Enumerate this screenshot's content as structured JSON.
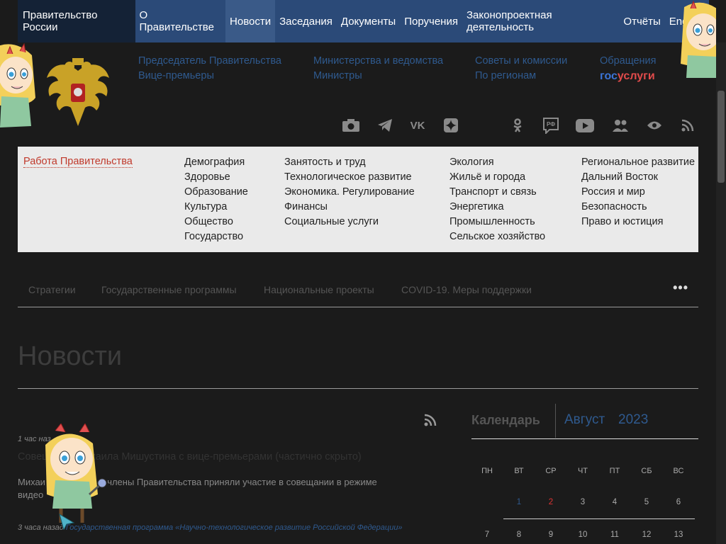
{
  "topnav": {
    "brand": "Правительство России",
    "items": [
      "О Правительстве",
      "Новости",
      "Заседания",
      "Документы",
      "Поручения",
      "Законопроектная деятельность",
      "Отчёты",
      "Eng"
    ],
    "active_index": 1
  },
  "header_links": {
    "col1": [
      "Председатель Правительства",
      "Вице-премьеры"
    ],
    "col2": [
      "Министерства и ведомства",
      "Министры"
    ],
    "col3": [
      "Советы и комиссии",
      "По регионам"
    ],
    "col4_top": "Обращения",
    "gosuslugi": {
      "part1": "гос",
      "part2": "услуги"
    }
  },
  "social_icons": [
    "camera-icon",
    "telegram-icon",
    "vk-icon",
    "zen-icon",
    "odnoklassniki-icon",
    "rutube-icon",
    "youtube-icon",
    "community-icon",
    "accessibility-eye-icon",
    "rss-icon"
  ],
  "social_glyphs": {
    "vk": "VK",
    "rf": "РФ"
  },
  "topics": {
    "work": "Работа Правительства",
    "col1": [
      "Демография",
      "Здоровье",
      "Образование",
      "Культура",
      "Общество",
      "Государство"
    ],
    "col2": [
      "Занятость и труд",
      "Технологическое развитие",
      "Экономика. Регулирование",
      "Финансы",
      "Социальные услуги"
    ],
    "col3": [
      "Экология",
      "Жильё и города",
      "Транспорт и связь",
      "Энергетика",
      "Промышленность",
      "Сельское хозяйство"
    ],
    "col4": [
      "Региональное развитие",
      "Дальний Восток",
      "Россия и мир",
      "Безопасность",
      "Право и юстиция"
    ]
  },
  "subnav": [
    "Стратегии",
    "Государственные программы",
    "Национальные проекты",
    "COVID-19. Меры поддержки"
  ],
  "subnav_more": "•••",
  "page_title": "Новости",
  "news": [
    {
      "time": "1 час наз",
      "title": "Совещание Михаила Мишустина с вице-премьерами (частично скрыто)",
      "lead_visible_start": "Михаи",
      "lead_visible_end": "члены Правительства приняли участие в совещании в режиме",
      "lead_line2": "видео"
    },
    {
      "time": "3 часа назад",
      "tag": "Государственная программа «Научно-технологическое развитие Российской Федерации»"
    }
  ],
  "calendar": {
    "label": "Календарь",
    "month": "Август",
    "year": "2023",
    "weekdays": [
      "ПН",
      "ВТ",
      "СР",
      "ЧТ",
      "ПТ",
      "СБ",
      "ВС"
    ],
    "week1": [
      "",
      "1",
      "2",
      "3",
      "4",
      "5",
      "6"
    ],
    "week2": [
      "7",
      "8",
      "9",
      "10",
      "11",
      "12",
      "13"
    ]
  },
  "colors": {
    "topnav": "#2b4a78",
    "brand": "#142236",
    "link": "#2f5a8f",
    "accent_red": "#c0392b"
  }
}
